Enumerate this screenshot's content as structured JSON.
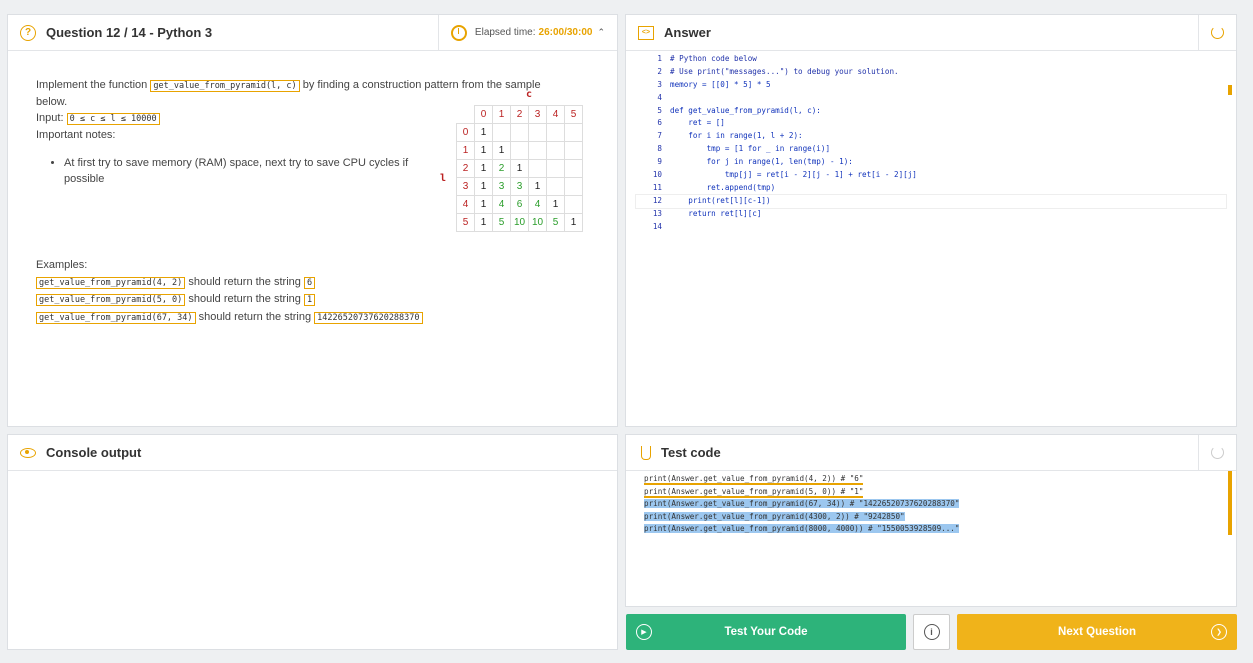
{
  "question": {
    "title": "Question 12 / 14 - Python 3",
    "timer_label": "Elapsed time:",
    "timer_value": "26:00/30:00",
    "intro_1": "Implement the function",
    "func_sig": "get_value_from_pyramid(l, c)",
    "intro_2": "by finding a construction pattern from the sample below.",
    "input_label": "Input:",
    "input_constraint": "0 ≤ c ≤ l ≤ 10000",
    "notes_label": "Important notes:",
    "note_1": "At first try to save memory (RAM) space, next try to save CPU cycles if possible",
    "pyramid": {
      "c_label": "c",
      "l_label": "l",
      "header": [
        "0",
        "1",
        "2",
        "3",
        "4",
        "5"
      ],
      "rows": [
        {
          "h": "0",
          "cells": [
            "1",
            "",
            "",
            "",
            "",
            ""
          ]
        },
        {
          "h": "1",
          "cells": [
            "1",
            "1",
            "",
            "",
            "",
            ""
          ]
        },
        {
          "h": "2",
          "cells": [
            "1",
            "2",
            "1",
            "",
            "",
            ""
          ]
        },
        {
          "h": "3",
          "cells": [
            "1",
            "3",
            "3",
            "1",
            "",
            ""
          ]
        },
        {
          "h": "4",
          "cells": [
            "1",
            "4",
            "6",
            "4",
            "1",
            ""
          ]
        },
        {
          "h": "5",
          "cells": [
            "1",
            "5",
            "10",
            "10",
            "5",
            "1"
          ]
        }
      ]
    },
    "examples_label": "Examples:",
    "examples": [
      {
        "call": "get_value_from_pyramid(4, 2)",
        "text": "should return the string",
        "result": "6"
      },
      {
        "call": "get_value_from_pyramid(5, 0)",
        "text": "should return the string",
        "result": "1"
      },
      {
        "call": "get_value_from_pyramid(67, 34)",
        "text": "should return the string",
        "result": "14226520737620288370"
      }
    ]
  },
  "answer": {
    "title": "Answer",
    "lines": [
      "# Python code below",
      "# Use print(\"messages...\") to debug your solution.",
      "memory = [[0] * 5] * 5",
      "",
      "def get_value_from_pyramid(l, c):",
      "    ret = []",
      "    for i in range(1, l + 2):",
      "        tmp = [1 for _ in range(i)]",
      "        for j in range(1, len(tmp) - 1):",
      "            tmp[j] = ret[i - 2][j - 1] + ret[i - 2][j]",
      "        ret.append(tmp)",
      "    print(ret[l][c-1])",
      "    return ret[l][c]",
      ""
    ]
  },
  "console": {
    "title": "Console output"
  },
  "test": {
    "title": "Test code",
    "lines": [
      "print(Answer.get_value_from_pyramid(4, 2)) # \"6\"",
      "print(Answer.get_value_from_pyramid(5, 0)) # \"1\"",
      "print(Answer.get_value_from_pyramid(67, 34)) # \"14226520737620288370\"",
      "print(Answer.get_value_from_pyramid(4300, 2)) # \"9242850\"",
      "print(Answer.get_value_from_pyramid(8000, 4000)) # \"1550053928509...\""
    ]
  },
  "buttons": {
    "test": "Test Your Code",
    "next": "Next Question"
  },
  "colors": {
    "accent": "#e8a300",
    "test_button": "#2db37a",
    "next_button": "#f0b31a"
  }
}
